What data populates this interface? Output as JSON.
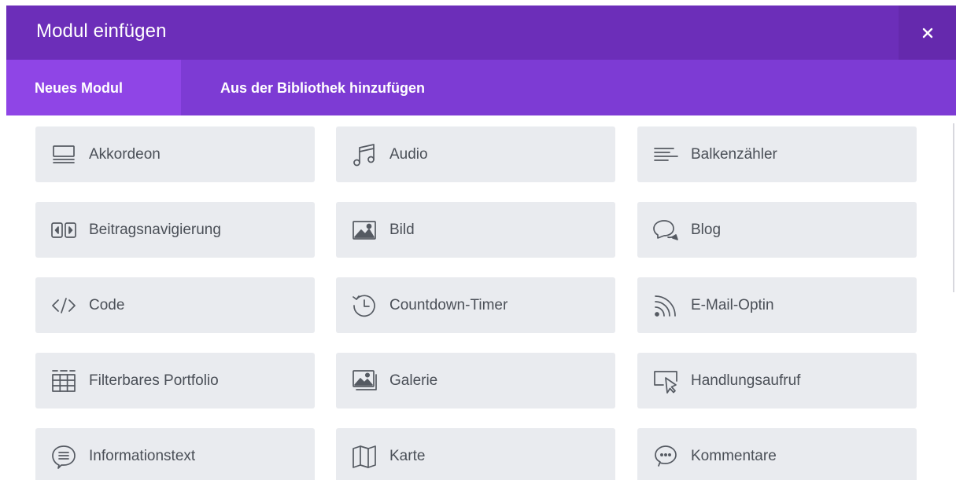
{
  "dialog": {
    "title": "Modul einfügen",
    "close_icon": "close-icon"
  },
  "tabs": [
    {
      "label": "Neues Modul",
      "active": true
    },
    {
      "label": "Aus der Bibliothek hinzufügen",
      "active": false
    }
  ],
  "modules": [
    {
      "label": "Akkordeon",
      "icon": "accordion-icon"
    },
    {
      "label": "Audio",
      "icon": "music-note-icon"
    },
    {
      "label": "Balkenzähler",
      "icon": "bar-counter-icon"
    },
    {
      "label": "Beitragsnavigierung",
      "icon": "post-navigation-icon"
    },
    {
      "label": "Bild",
      "icon": "image-icon"
    },
    {
      "label": "Blog",
      "icon": "chat-bubbles-icon"
    },
    {
      "label": "Code",
      "icon": "code-icon"
    },
    {
      "label": "Countdown-Timer",
      "icon": "countdown-clock-icon"
    },
    {
      "label": "E-Mail-Optin",
      "icon": "rss-icon"
    },
    {
      "label": "Filterbares Portfolio",
      "icon": "grid-filter-icon"
    },
    {
      "label": "Galerie",
      "icon": "gallery-icon"
    },
    {
      "label": "Handlungsaufruf",
      "icon": "pointer-click-icon"
    },
    {
      "label": "Informationstext",
      "icon": "text-bubble-icon"
    },
    {
      "label": "Karte",
      "icon": "map-icon"
    },
    {
      "label": "Kommentare",
      "icon": "comment-bubble-icon"
    }
  ],
  "colors": {
    "header": "#6c2eb9",
    "tab_bar": "#7d3bd4",
    "active_tab": "#8f45e6",
    "module_bg": "#e9ebef",
    "text": "#4a4f57"
  }
}
